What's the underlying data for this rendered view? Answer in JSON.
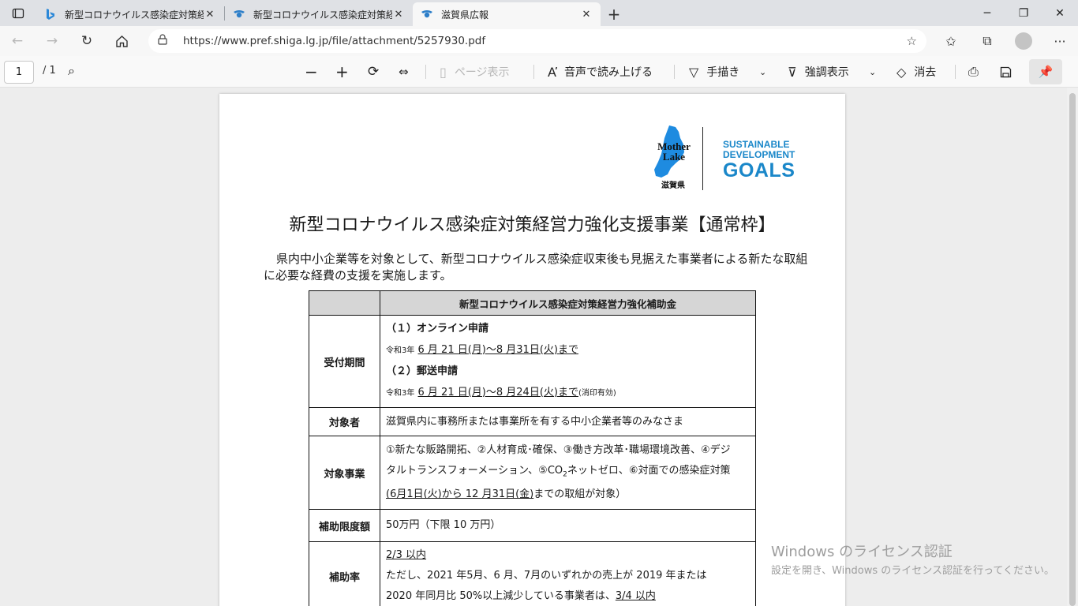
{
  "browser": {
    "tabs": [
      {
        "title": "新型コロナウイルス感染症対策経営",
        "favicon": "bing-icon",
        "active": false
      },
      {
        "title": "新型コロナウイルス感染症対策経営",
        "favicon": "shiga-icon",
        "active": false
      },
      {
        "title": "滋賀県広報",
        "favicon": "shiga-icon",
        "active": true
      }
    ],
    "url": "https://www.pref.shiga.lg.jp/file/attachment/5257930.pdf"
  },
  "pdf_toolbar": {
    "page_current": "1",
    "page_total": "/ 1",
    "page_view": "ページ表示",
    "read_aloud": "音声で読み上げる",
    "draw": "手描き",
    "highlight": "強調表示",
    "erase": "消去"
  },
  "document": {
    "logo": {
      "line1": "Mother",
      "line2": "Lake",
      "pref": "滋賀県"
    },
    "sdg": {
      "line1": "SUSTAINABLE",
      "line2": "DEVELOPMENT",
      "line3": "GOALS"
    },
    "title": "新型コロナウイルス感染症対策経営力強化支援事業【通常枠】",
    "intro": "県内中小企業等を対象として、新型コロナウイルス感染症収束後も見据えた事業者による新たな取組に必要な経費の支援を実施します。",
    "table_header": "新型コロナウイルス感染症対策経営力強化補助金",
    "rows": {
      "period": {
        "label": "受付期間",
        "online_title": "（１）オンライン申請",
        "online_era": "令和3年",
        "online_dates": "6 月 21 日(月)～8 月31日(火)まで",
        "mail_title": "（２）郵送申請",
        "mail_era": "令和3年",
        "mail_dates": "6 月 21 日(月)～8 月24日(火)まで",
        "mail_note": "(消印有効)"
      },
      "target": {
        "label": "対象者",
        "value": "滋賀県内に事務所または事業所を有する中小企業者等のみなさま"
      },
      "project": {
        "label": "対象事業",
        "line1": "①新たな販路開拓、②人材育成･確保、③働き方改革･職場環境改善、④デジ",
        "line2a": "タルトランスフォーメーション、⑤CO",
        "line2sub": "2",
        "line2b": "ネットゼロ、⑥対面での感染症対策",
        "line3a": "(6月1日(火)から 12 月31日(金)",
        "line3b": "までの取組が対象）"
      },
      "limit": {
        "label": "補助限度額",
        "value": "50万円（下限  10 万円）"
      },
      "rate": {
        "label": "補助率",
        "line1": "2/3 以内",
        "line2": "ただし、2021 年5月、6 月、7月のいずれかの売上が 2019 年または",
        "line3a": "2020 年同月比 50%以上減少している事業者は、",
        "line3b": "3/4 以内"
      }
    }
  },
  "watermark": {
    "line1": "Windows のライセンス認証",
    "line2": "設定を開き、Windows のライセンス認証を行ってください。"
  }
}
